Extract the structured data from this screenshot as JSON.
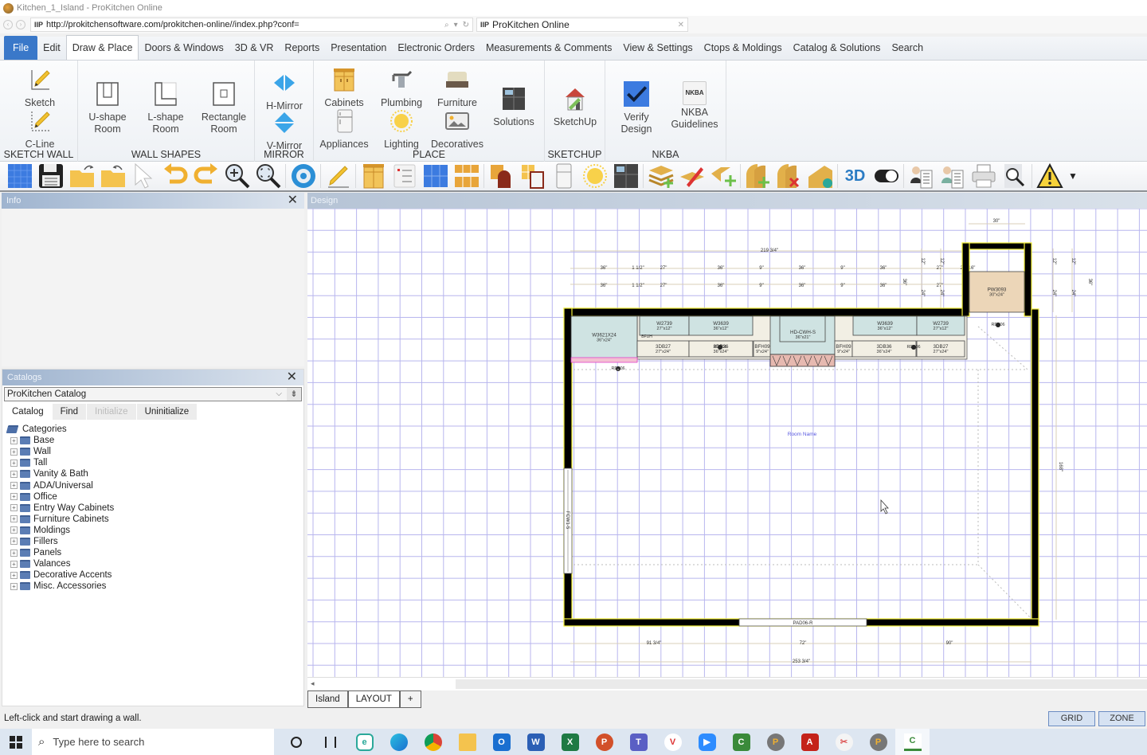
{
  "window": {
    "title": "Kitchen_1_Island - ProKitchen Online"
  },
  "browser": {
    "url": "http://prokitchensoftware.com/prokitchen-online//index.php?conf=",
    "tab_title": "ProKitchen Online",
    "search_glyph": "⌕",
    "refresh_glyph": "↻"
  },
  "menu": {
    "items": [
      "File",
      "Edit",
      "Draw & Place",
      "Doors & Windows",
      "3D & VR",
      "Reports",
      "Presentation",
      "Electronic Orders",
      "Measurements & Comments",
      "View & Settings",
      "Ctops & Moldings",
      "Catalog & Solutions",
      "Search"
    ],
    "active": "Draw & Place"
  },
  "ribbon": {
    "groups": {
      "sketch_wall": "SKETCH WALL",
      "wall_shapes": "WALL SHAPES",
      "mirror": "MIRROR",
      "place": "PLACE",
      "sketchup": "SKETCHUP",
      "nkba": "NKBA"
    },
    "buttons": {
      "sketch": "Sketch",
      "cline": "C-Line",
      "ushape_1": "U-shape",
      "ushape_2": "Room",
      "lshape_1": "L-shape",
      "lshape_2": "Room",
      "rect_1": "Rectangle",
      "rect_2": "Room",
      "hmirror": "H-Mirror",
      "vmirror": "V-Mirror",
      "cabinets": "Cabinets",
      "appliances": "Appliances",
      "plumbing": "Plumbing",
      "lighting": "Lighting",
      "furniture": "Furniture",
      "decoratives": "Decoratives",
      "solutions": "Solutions",
      "sketchup": "SketchUp",
      "verify_1": "Verify",
      "verify_2": "Design",
      "nkba_1": "NKBA",
      "nkba_2": "Guidelines",
      "nkba_badge": "NKBA"
    }
  },
  "toolbar": {
    "threed_label": "3D"
  },
  "info_panel": {
    "title": "Info"
  },
  "catalogs_panel": {
    "title": "Catalogs",
    "selected_catalog": "ProKitchen Catalog",
    "tabs": [
      "Catalog",
      "Find",
      "Initialize",
      "Uninitialize"
    ],
    "root": "Categories",
    "categories": [
      "Base",
      "Wall",
      "Tall",
      "Vanity & Bath",
      "ADA/Universal",
      "Office",
      "Entry Way Cabinets",
      "Furniture Cabinets",
      "Moldings",
      "Fillers",
      "Panels",
      "Valances",
      "Decorative Accents",
      "Misc. Accessories"
    ]
  },
  "design": {
    "title": "Design",
    "room_name": "Room Name",
    "cabinets": [
      {
        "code": "W3621X24",
        "size": "36\"x24\""
      },
      {
        "code": "W2739",
        "size": "27\"x12\""
      },
      {
        "code": "W3639",
        "size": "36\"x12\""
      },
      {
        "code": "HD-CWH-S",
        "size": "36\"x21\""
      },
      {
        "code": "W3639",
        "size": "36\"x12\""
      },
      {
        "code": "W2739",
        "size": "27\"x12\""
      },
      {
        "code": "3DB27",
        "size": "27\"x24\""
      },
      {
        "code": "3DB36",
        "size": "36\"x24\""
      },
      {
        "code": "BFH09",
        "size": "9\"x24\""
      },
      {
        "code": "BFH09",
        "size": "9\"x24\""
      },
      {
        "code": "3DB36",
        "size": "36\"x24\""
      },
      {
        "code": "3DB27",
        "size": "27\"x24\""
      },
      {
        "code": "PW3093",
        "size": "30\"x24\""
      }
    ],
    "fixtures": {
      "left_window": "FCW1-5",
      "bottom_door": "PAD06-R",
      "outlet": "RD006",
      "filler": "BFUH"
    },
    "dimensions": {
      "top_total": "219 3/4\"",
      "top_row": [
        "36\"",
        "1 1/2\"",
        "27\"",
        "36\"",
        "9\"",
        "36\"",
        "9\"",
        "36\"",
        "27\"",
        "2 3/16\""
      ],
      "top_row2": [
        "36\"",
        "1 1/2\"",
        "27\"",
        "36\"",
        "9\"",
        "36\"",
        "9\"",
        "36\"",
        "27\"",
        "2 3/8\""
      ],
      "pantry_width": "30\"",
      "vertical": [
        "12\"",
        "12\"",
        "24\"",
        "24\"",
        "36\"",
        "36\""
      ],
      "bottom_row": [
        "91 3/4\"",
        "72\"",
        "90\""
      ],
      "bottom_total": "253 3/4\"",
      "right_height": "168\""
    }
  },
  "page_tabs": {
    "items": [
      "Island",
      "LAYOUT"
    ],
    "add": "+"
  },
  "status": {
    "message": "Left-click and start drawing a wall.",
    "grid": "GRID",
    "zone": "ZONE"
  },
  "taskbar": {
    "search_placeholder": "Type here to search"
  }
}
